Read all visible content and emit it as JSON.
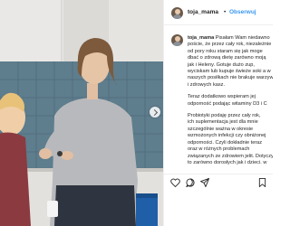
{
  "app": "Instagram",
  "post": {
    "username": "toja_mama",
    "separator": "•",
    "follow_label": "Obserwuj"
  },
  "caption": {
    "username": "toja_mama",
    "first_line": "Pisałam Wam niedawno",
    "paragraph1": [
      "poście, że przez cały rok, niezależnie",
      "od pory roku staram się jak moge",
      "dbać o zdrową dietę zarówno moją",
      "jak i Heleny. Gotuje dużo zup,",
      "wyciskam lub kupuje świeże soki a w",
      "naszych posiłkach nie brakuje warzyw",
      "i zdrowych kasz."
    ],
    "paragraph2": [
      "Teraz dodatkowo wspieram jej",
      "odporność podając witaminy D3 i C"
    ],
    "paragraph3": [
      "Probiotyki podaję przez cały rok,",
      "ich suplementacja jest dla mnie",
      "szczególnie ważna w okresie",
      "wzmożonych infekcji czy obniżonej",
      "odporności. Czyli dokładnie teraz",
      "oraz w różnych problemach",
      "związanych ze zdrowiem jelit. Dotyczy",
      "to zarówno dorosłych jak i dzieci. w"
    ]
  },
  "actions": {
    "icons": [
      "heart-icon",
      "comment-icon",
      "share-icon",
      "bookmark-icon"
    ]
  },
  "colors": {
    "link": "#3897f0",
    "text": "#262626",
    "tile": "#5d7c8c"
  }
}
